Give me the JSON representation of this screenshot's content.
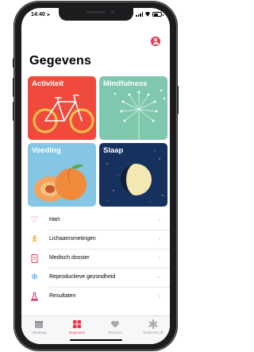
{
  "status_bar": {
    "time": "14:40"
  },
  "header": {
    "title": "Gegevens"
  },
  "categories": [
    {
      "label": "Activiteit",
      "color": "#ef4a3c"
    },
    {
      "label": "Mindfulness",
      "color": "#7fc8ad"
    },
    {
      "label": "Voeding",
      "color": "#84c6e3"
    },
    {
      "label": "Slaap",
      "color": "#17315e"
    }
  ],
  "list_items": [
    {
      "label": "Hart",
      "icon": "heart-icon"
    },
    {
      "label": "Lichaamsmetingen",
      "icon": "person-icon"
    },
    {
      "label": "Medisch dossier",
      "icon": "clipboard-icon"
    },
    {
      "label": "Reproductieve gezondheid",
      "icon": "snowflake-icon"
    },
    {
      "label": "Resultaten",
      "icon": "flask-icon"
    }
  ],
  "tabs": [
    {
      "label": "Vandaag",
      "icon": "calendar-icon",
      "active": false
    },
    {
      "label": "Gegevens",
      "icon": "grid-icon",
      "active": true
    },
    {
      "label": "Bronnen",
      "icon": "heart-sources-icon",
      "active": false
    },
    {
      "label": "Medische ID",
      "icon": "asterisk-icon",
      "active": false
    }
  ],
  "colors": {
    "accent": "#e8374d"
  }
}
